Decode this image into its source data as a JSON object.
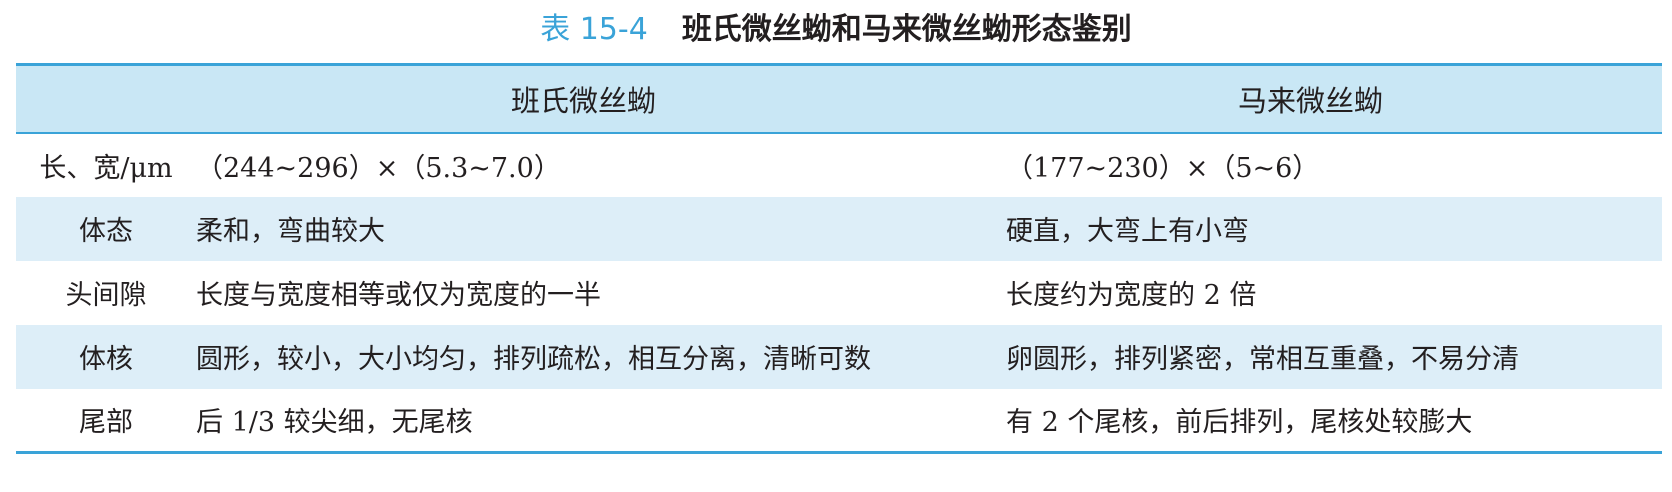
{
  "caption": {
    "number": "表 15-4",
    "title": "班氏微丝蚴和马来微丝蚴形态鉴别"
  },
  "table": {
    "headers": [
      "",
      "班氏微丝蚴",
      "马来微丝蚴"
    ],
    "rows": [
      {
        "label": "长、宽/μm",
        "a": "（244~296）×（5.3~7.0）",
        "b": "（177~230）×（5~6）"
      },
      {
        "label": "体态",
        "a": "柔和，弯曲较大",
        "b": "硬直，大弯上有小弯"
      },
      {
        "label": "头间隙",
        "a": "长度与宽度相等或仅为宽度的一半",
        "b": "长度约为宽度的 2 倍"
      },
      {
        "label": "体核",
        "a": "圆形，较小，大小均匀，排列疏松，相互分离，清晰可数",
        "b": "卵圆形，排列紧密，常相互重叠，不易分清"
      },
      {
        "label": "尾部",
        "a": "后 1/3 较尖细，无尾核",
        "b": "有 2 个尾核，前后排列，尾核处较膨大"
      }
    ]
  },
  "colors": {
    "accent": "#3aa3d8",
    "header_bg": "#c9e7f5",
    "alt_row_bg": "#ddeef8"
  }
}
